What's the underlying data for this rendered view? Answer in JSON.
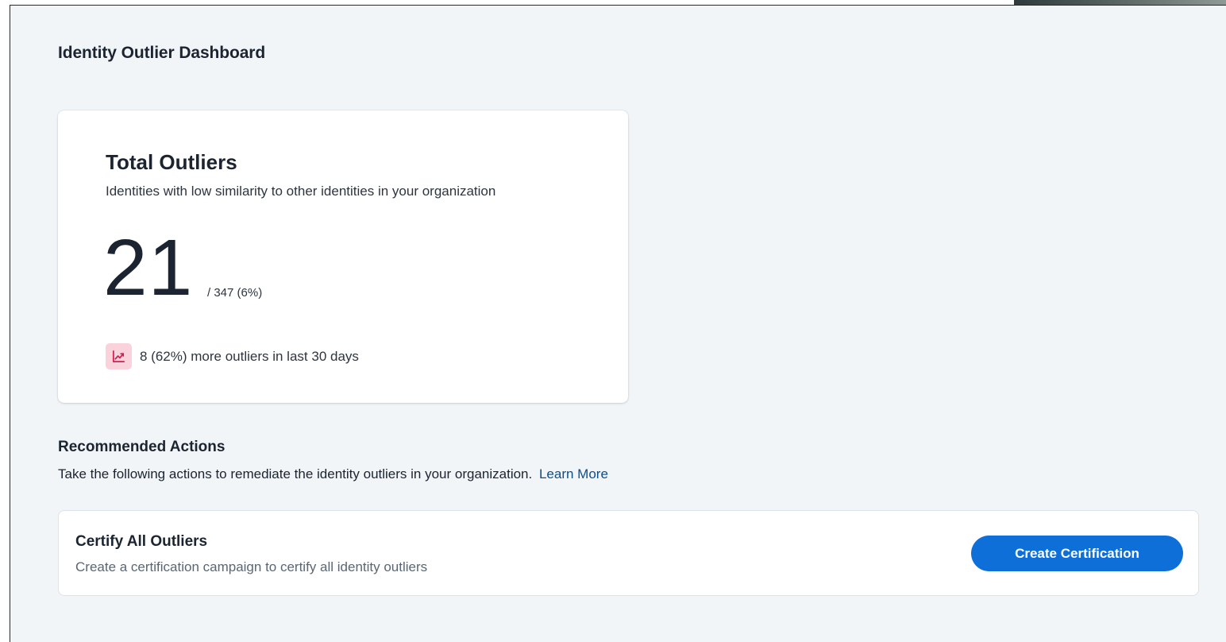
{
  "page": {
    "title": "Identity Outlier Dashboard"
  },
  "outliers_card": {
    "title": "Total Outliers",
    "subtitle": "Identities with low similarity to other identities in your organization",
    "count": "21",
    "total_text": "/ 347 (6%)",
    "trend_icon": "trending-up-icon",
    "trend_text": "8 (62%) more outliers in last 30 days"
  },
  "recommended_actions": {
    "title": "Recommended Actions",
    "description": "Take the following actions to remediate the identity outliers in your organization.",
    "learn_more_label": "Learn More",
    "actions": [
      {
        "title": "Certify All Outliers",
        "description": "Create a certification campaign to certify all identity outliers",
        "button_label": "Create Certification"
      }
    ]
  },
  "colors": {
    "page_background": "#f2f5f8",
    "card_background": "#ffffff",
    "primary_button": "#0f6fd8",
    "trend_icon_background": "#f9d2dc",
    "trend_icon_stroke": "#d21f4f",
    "link": "#0b4f8a"
  }
}
